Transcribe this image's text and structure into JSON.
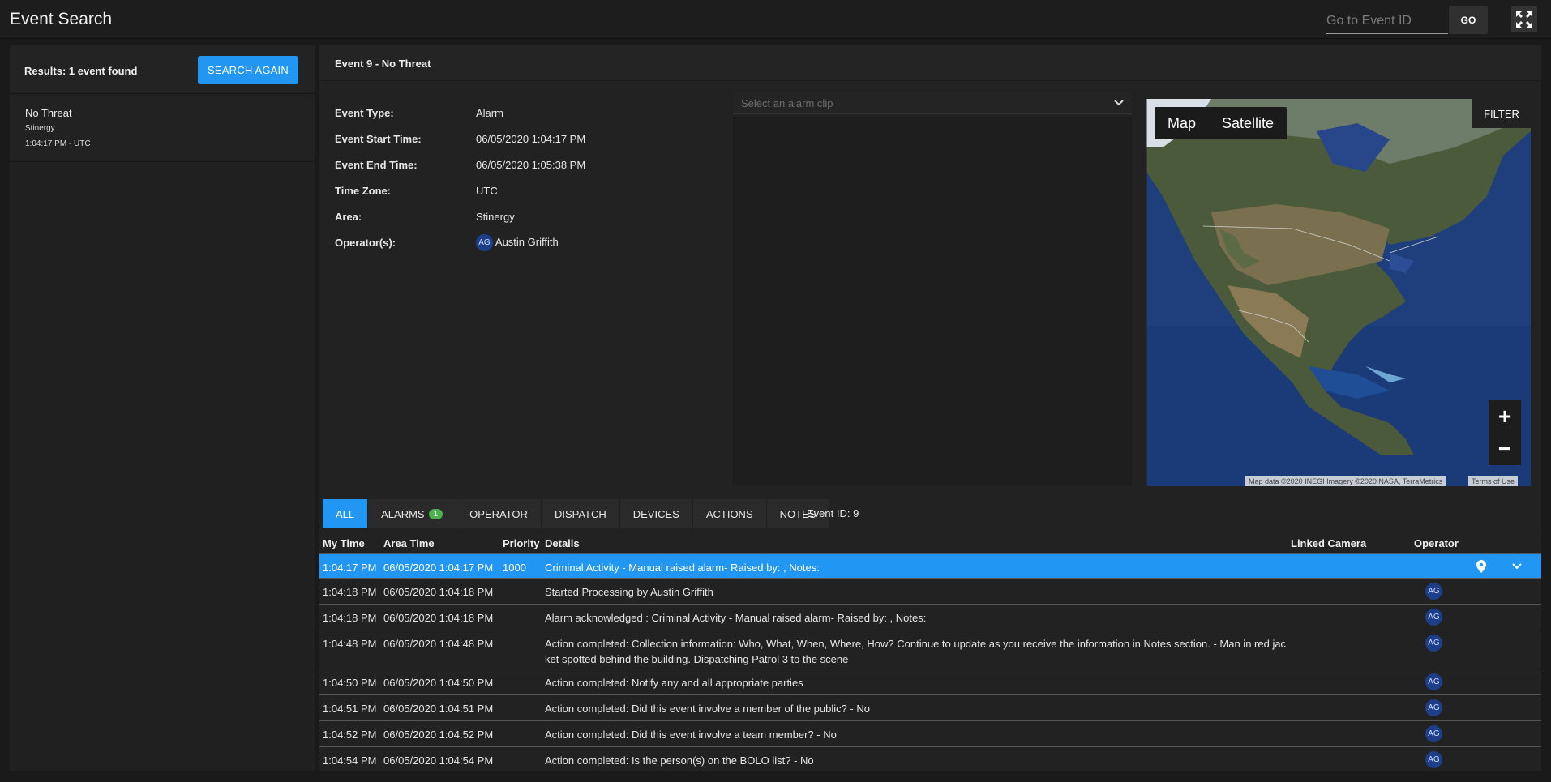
{
  "app": {
    "title": "Event Search",
    "goto_placeholder": "Go to Event ID",
    "go_label": "GO",
    "fullscreen_icon": "fullscreen-icon"
  },
  "results": {
    "summary": "Results: 1 event found",
    "search_again_label": "SEARCH AGAIN",
    "items": [
      {
        "title": "No Threat",
        "area": "Stinergy",
        "time": "1:04:17 PM - UTC"
      }
    ]
  },
  "event": {
    "title": "Event 9 - No Threat",
    "fields": [
      {
        "label": "Event Type:",
        "value": "Alarm"
      },
      {
        "label": "Event Start Time:",
        "value": "06/05/2020 1:04:17 PM"
      },
      {
        "label": "Event End Time:",
        "value": "06/05/2020 1:05:38 PM"
      },
      {
        "label": "Time Zone:",
        "value": "UTC"
      },
      {
        "label": "Area:",
        "value": "Stinergy"
      },
      {
        "label": "Operator(s):",
        "value": "Austin Griffith",
        "avatar": "AG"
      }
    ],
    "clip_placeholder": "Select an alarm clip"
  },
  "map": {
    "tab_map": "Map",
    "tab_satellite": "Satellite",
    "filter_label": "FILTER",
    "zoom_in": "+",
    "zoom_out": "−",
    "attribution": "Map data ©2020 INEGI Imagery ©2020 NASA, TerraMetrics",
    "terms": "Terms of Use"
  },
  "tabs": {
    "all": "ALL",
    "alarms": "ALARMS",
    "alarms_count": "1",
    "operator": "OPERATOR",
    "dispatch": "DISPATCH",
    "devices": "DEVICES",
    "actions": "ACTIONS",
    "notes": "NOTES",
    "event_id": "Event ID: 9"
  },
  "table": {
    "headers": {
      "my_time": "My Time",
      "area_time": "Area Time",
      "priority": "Priority",
      "details": "Details",
      "linked_camera": "Linked Camera",
      "operator": "Operator"
    },
    "rows": [
      {
        "my_time": "1:04:17 PM",
        "area_time": "06/05/2020 1:04:17 PM",
        "priority": "1000",
        "details": "Criminal Activity - Manual raised alarm- Raised by: , Notes:",
        "operator": ""
      },
      {
        "my_time": "1:04:18 PM",
        "area_time": "06/05/2020 1:04:18 PM",
        "priority": "",
        "details": "Started Processing by Austin Griffith",
        "operator": "AG"
      },
      {
        "my_time": "1:04:18 PM",
        "area_time": "06/05/2020 1:04:18 PM",
        "priority": "",
        "details": "Alarm acknowledged : Criminal Activity - Manual raised alarm- Raised by: , Notes:",
        "operator": "AG"
      },
      {
        "my_time": "1:04:48 PM",
        "area_time": "06/05/2020 1:04:48 PM",
        "priority": "",
        "details": "Action completed: Collection information: Who, What, When, Where, How? Continue to update as you receive the information in Notes section. - Man in red jacket spotted behind the building. Dispatching Patrol 3 to the scene",
        "operator": "AG"
      },
      {
        "my_time": "1:04:50 PM",
        "area_time": "06/05/2020 1:04:50 PM",
        "priority": "",
        "details": "Action completed: Notify any and all appropriate parties",
        "operator": "AG"
      },
      {
        "my_time": "1:04:51 PM",
        "area_time": "06/05/2020 1:04:51 PM",
        "priority": "",
        "details": "Action completed: Did this event involve a member of the public? - No",
        "operator": "AG"
      },
      {
        "my_time": "1:04:52 PM",
        "area_time": "06/05/2020 1:04:52 PM",
        "priority": "",
        "details": "Action completed: Did this event involve a team member? - No",
        "operator": "AG"
      },
      {
        "my_time": "1:04:54 PM",
        "area_time": "06/05/2020 1:04:54 PM",
        "priority": "",
        "details": "Action completed: Is the person(s) on the BOLO list? - No",
        "operator": "AG"
      }
    ]
  },
  "colors": {
    "accent": "#2196f3",
    "badge": "#4caf50",
    "avatar": "#1d3f8a"
  }
}
